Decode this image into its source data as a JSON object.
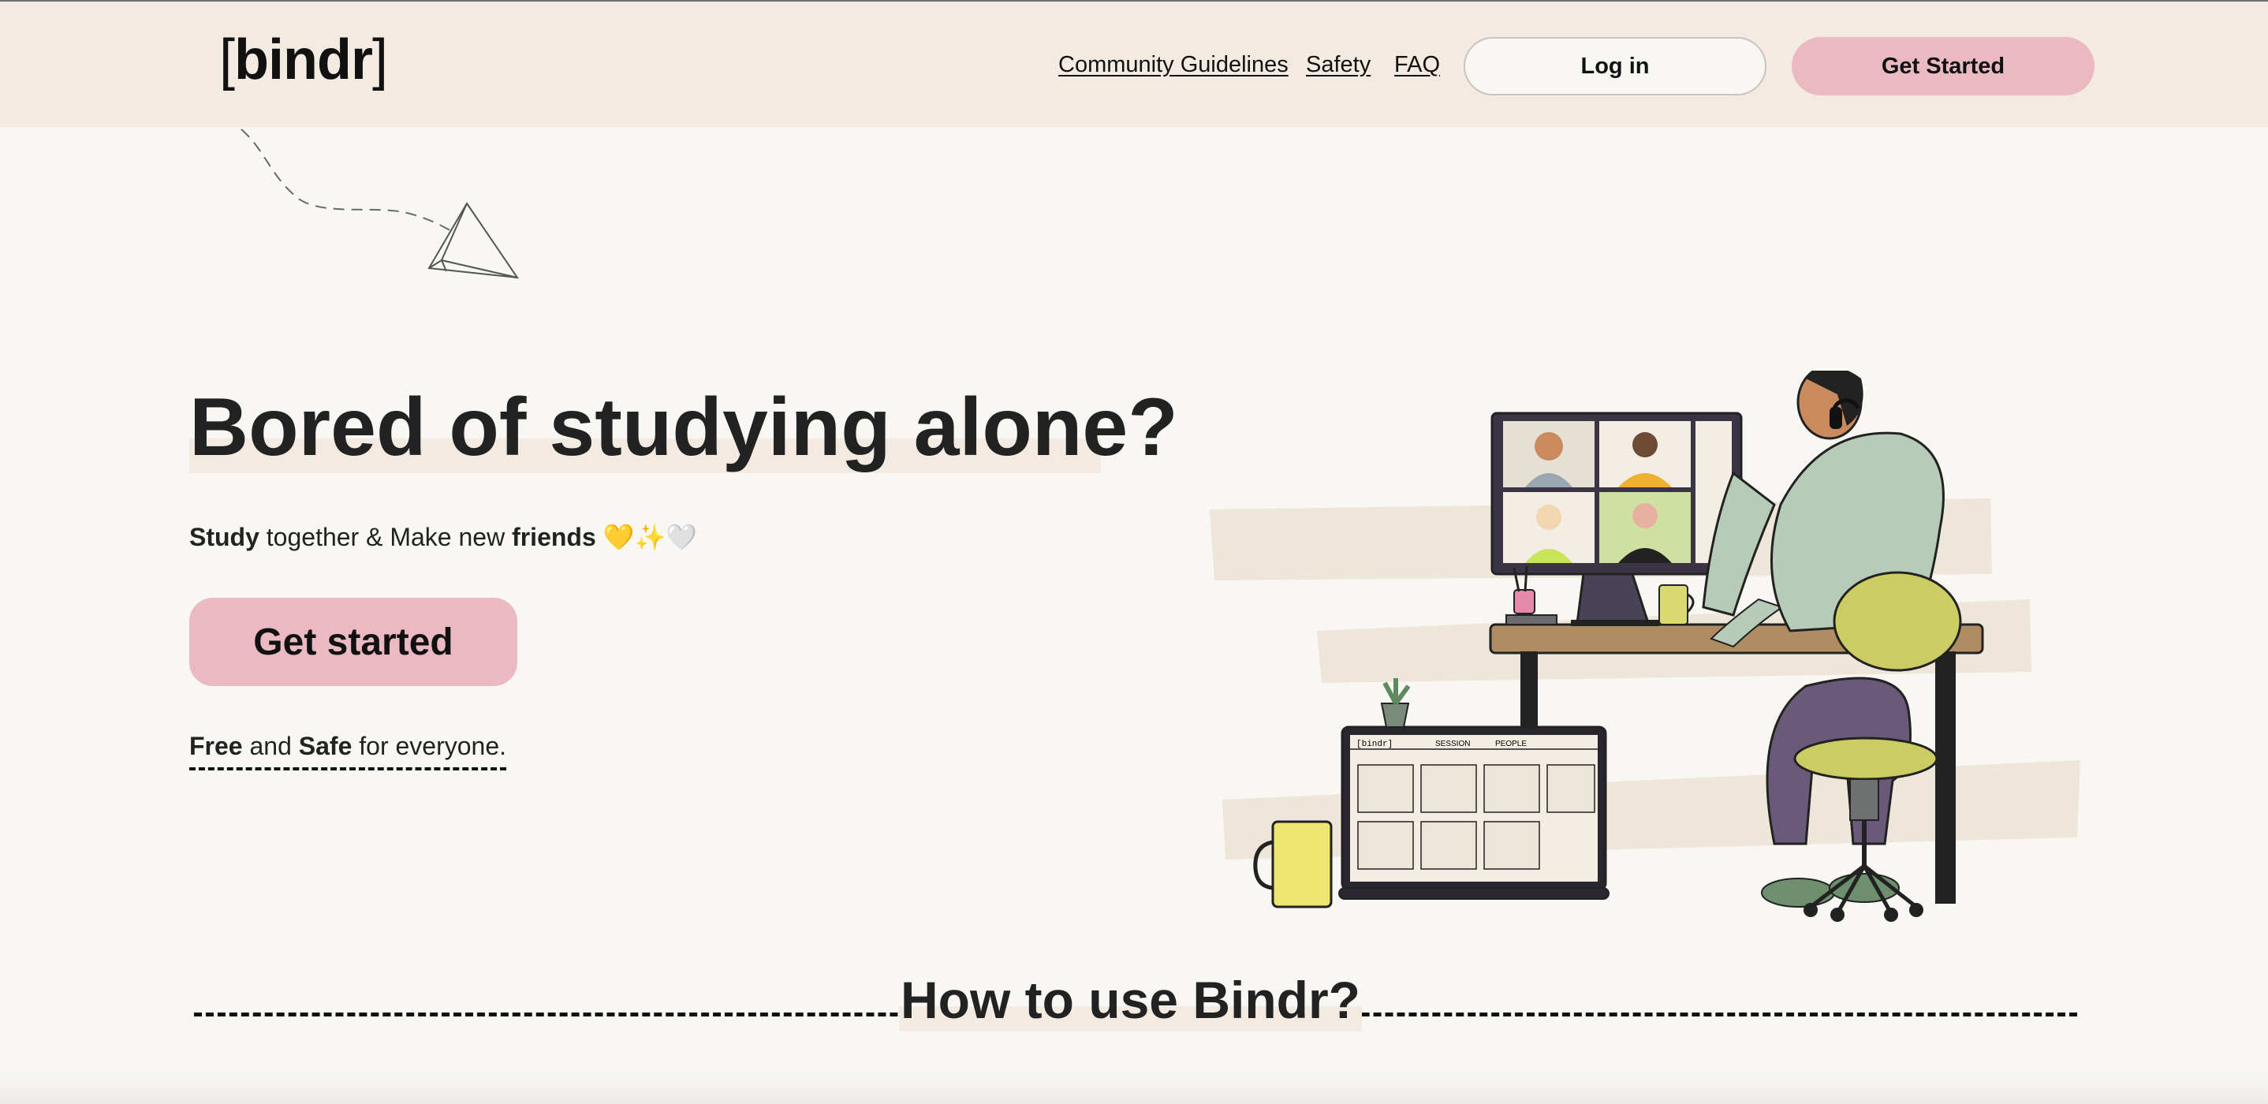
{
  "header": {
    "logo_left_bracket": "[",
    "logo_word": "bindr",
    "logo_right_bracket": "]",
    "nav": {
      "community": "Community Guidelines",
      "safety": "Safety",
      "faq": "FAQ"
    },
    "login_label": "Log in",
    "get_started_label": "Get Started"
  },
  "hero": {
    "title": "Bored of studying alone?",
    "subtitle": {
      "study": "Study",
      "together": " together & Make new ",
      "friends": "friends",
      "emojis": " 💛✨🤍"
    },
    "cta_label": "Get started",
    "free_line": {
      "free": "Free",
      "and": " and ",
      "safe": "Safe",
      "rest": " for everyone."
    }
  },
  "illustration": {
    "laptop_logo": "[bindr]",
    "laptop_tabs": [
      "SESSION",
      "PEOPLE"
    ]
  },
  "section": {
    "howto_title": "How to use Bindr?"
  },
  "colors": {
    "header_bg": "#f3ebe1",
    "page_bg": "#f8f7f3",
    "accent_pink": "#eab9c2",
    "text": "#141414"
  },
  "icons": {
    "decor": "paper-plane-icon"
  }
}
